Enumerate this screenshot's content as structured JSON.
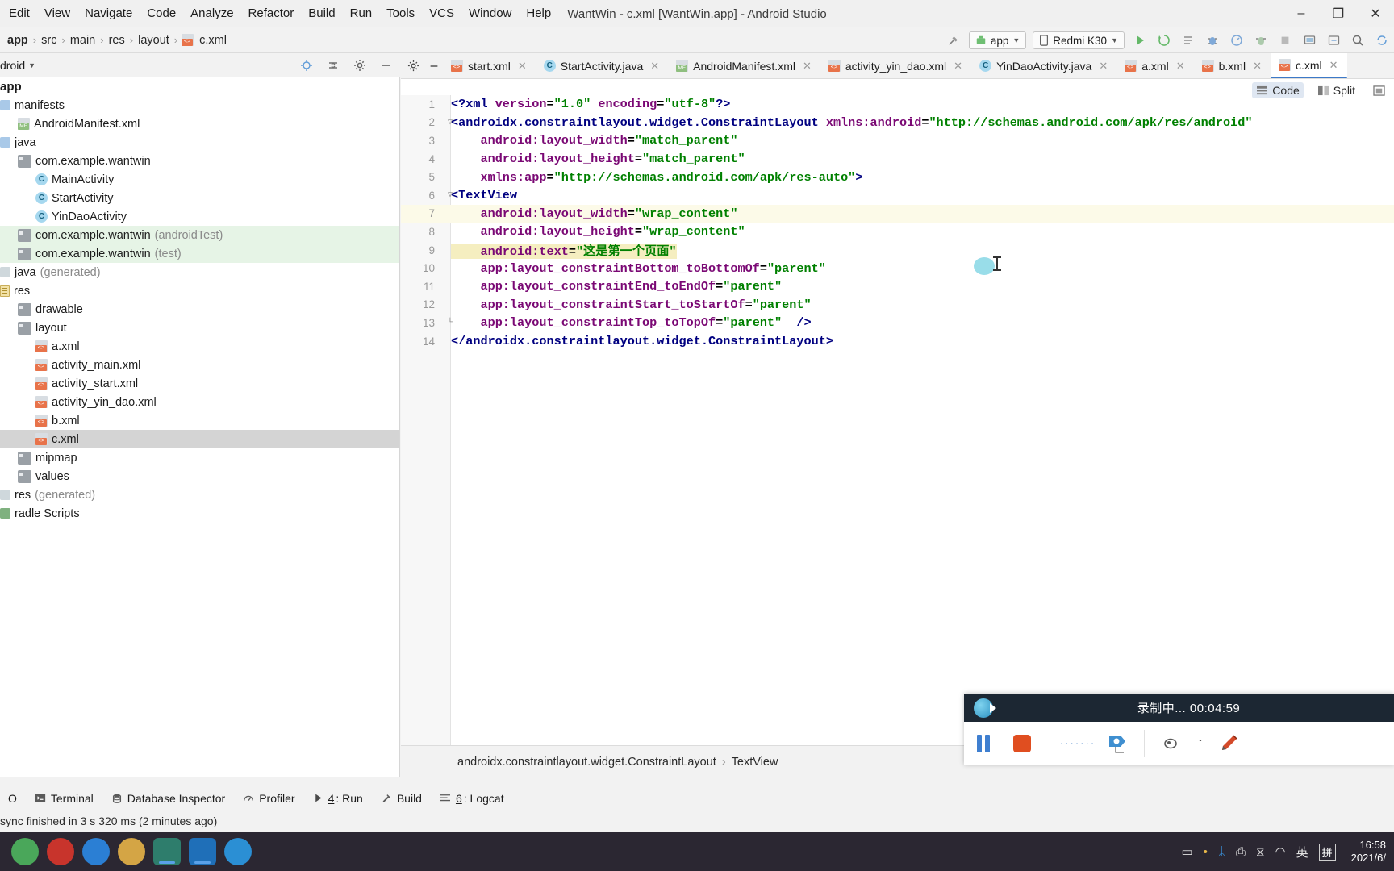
{
  "window": {
    "title": "WantWin - c.xml [WantWin.app] - Android Studio",
    "minimize": "–",
    "maximize": "❐",
    "close": "✕"
  },
  "menubar": [
    {
      "label": "Edit"
    },
    {
      "label": "View"
    },
    {
      "label": "Navigate"
    },
    {
      "label": "Code"
    },
    {
      "label": "Analyze"
    },
    {
      "label": "Refactor"
    },
    {
      "label": "Build"
    },
    {
      "label": "Run"
    },
    {
      "label": "Tools"
    },
    {
      "label": "VCS"
    },
    {
      "label": "Window"
    },
    {
      "label": "Help"
    }
  ],
  "breadcrumb": [
    "app",
    "src",
    "main",
    "res",
    "layout",
    "c.xml"
  ],
  "toolbar": {
    "hammer_icon": "hammer-icon",
    "run_config": "app",
    "device": "Redmi K30",
    "run_icon": "run-icon",
    "rerun_icon": "rerun-icon",
    "debug_icon": "debug-icon",
    "stop_icon": "stop-icon",
    "search_icon": "search-icon"
  },
  "project_panel": {
    "selector": "droid",
    "tree": [
      {
        "label": "app",
        "indent": 0,
        "icon": "app-module-icon",
        "bold": true,
        "state": "normal"
      },
      {
        "label": "manifests",
        "indent": 1,
        "icon": "source-root-icon",
        "state": "normal"
      },
      {
        "label": "AndroidManifest.xml",
        "indent": 2,
        "icon": "manifest-file-icon",
        "state": "normal"
      },
      {
        "label": "java",
        "indent": 1,
        "icon": "source-root-icon",
        "state": "normal"
      },
      {
        "label": "com.example.wantwin",
        "indent": 2,
        "icon": "package-icon",
        "state": "normal"
      },
      {
        "label": "MainActivity",
        "indent": 3,
        "icon": "class-icon",
        "state": "normal"
      },
      {
        "label": "StartActivity",
        "indent": 3,
        "icon": "class-icon",
        "state": "normal"
      },
      {
        "label": "YinDaoActivity",
        "indent": 3,
        "icon": "class-icon",
        "state": "normal"
      },
      {
        "label": "com.example.wantwin",
        "suffix": "(androidTest)",
        "indent": 2,
        "icon": "package-icon",
        "state": "green"
      },
      {
        "label": "com.example.wantwin",
        "suffix": "(test)",
        "indent": 2,
        "icon": "package-icon",
        "state": "green"
      },
      {
        "label": "java",
        "suffix": "(generated)",
        "indent": 1,
        "icon": "generated-icon",
        "state": "normal"
      },
      {
        "label": "res",
        "indent": 1,
        "icon": "res-root-icon",
        "state": "normal"
      },
      {
        "label": "drawable",
        "indent": 2,
        "icon": "package-icon",
        "state": "normal"
      },
      {
        "label": "layout",
        "indent": 2,
        "icon": "package-icon",
        "state": "normal"
      },
      {
        "label": "a.xml",
        "indent": 3,
        "icon": "xml-file-icon",
        "state": "normal"
      },
      {
        "label": "activity_main.xml",
        "indent": 3,
        "icon": "xml-file-icon",
        "state": "normal"
      },
      {
        "label": "activity_start.xml",
        "indent": 3,
        "icon": "xml-file-icon",
        "state": "normal"
      },
      {
        "label": "activity_yin_dao.xml",
        "indent": 3,
        "icon": "xml-file-icon",
        "state": "normal"
      },
      {
        "label": "b.xml",
        "indent": 3,
        "icon": "xml-file-icon",
        "state": "normal"
      },
      {
        "label": "c.xml",
        "indent": 3,
        "icon": "xml-file-icon",
        "state": "selected"
      },
      {
        "label": "mipmap",
        "indent": 2,
        "icon": "package-icon",
        "state": "normal"
      },
      {
        "label": "values",
        "indent": 2,
        "icon": "package-icon",
        "state": "normal"
      },
      {
        "label": "res",
        "suffix": "(generated)",
        "indent": 1,
        "icon": "generated-icon",
        "state": "normal"
      },
      {
        "label": "radle Scripts",
        "indent": 0,
        "icon": "gradle-icon",
        "state": "normal"
      }
    ]
  },
  "editor_tabs": [
    {
      "label": "start.xml",
      "icon": "xml-file-icon",
      "active": false
    },
    {
      "label": "StartActivity.java",
      "icon": "class-icon",
      "active": false
    },
    {
      "label": "AndroidManifest.xml",
      "icon": "manifest-file-icon",
      "active": false
    },
    {
      "label": "activity_yin_dao.xml",
      "icon": "xml-file-icon",
      "active": false
    },
    {
      "label": "YinDaoActivity.java",
      "icon": "class-icon",
      "active": false
    },
    {
      "label": "a.xml",
      "icon": "xml-file-icon",
      "active": false
    },
    {
      "label": "b.xml",
      "icon": "xml-file-icon",
      "active": false
    },
    {
      "label": "c.xml",
      "icon": "xml-file-icon",
      "active": true
    }
  ],
  "view_modes": [
    {
      "label": "Code",
      "icon": "code-view-icon",
      "active": true
    },
    {
      "label": "Split",
      "icon": "split-view-icon",
      "active": false
    },
    {
      "label": "",
      "icon": "design-view-icon",
      "active": false
    }
  ],
  "code": {
    "language": "xml",
    "lines": [
      {
        "n": 1,
        "fold": "",
        "highlight": false,
        "tokens": [
          {
            "t": "<?xml ",
            "c": "tag"
          },
          {
            "t": "version",
            "c": "attr"
          },
          {
            "t": "=",
            "c": "plain"
          },
          {
            "t": "\"1.0\"",
            "c": "val"
          },
          {
            "t": " ",
            "c": "plain"
          },
          {
            "t": "encoding",
            "c": "attr"
          },
          {
            "t": "=",
            "c": "plain"
          },
          {
            "t": "\"utf-8\"",
            "c": "val"
          },
          {
            "t": "?>",
            "c": "tag"
          }
        ]
      },
      {
        "n": 2,
        "fold": "-",
        "highlight": false,
        "tokens": [
          {
            "t": "<androidx.constraintlayout.widget.ConstraintLayout ",
            "c": "tag"
          },
          {
            "t": "xmlns:android",
            "c": "attr"
          },
          {
            "t": "=",
            "c": "plain"
          },
          {
            "t": "\"http://schemas.android.com/apk/res/android\"",
            "c": "val"
          }
        ]
      },
      {
        "n": 3,
        "fold": "",
        "highlight": false,
        "tokens": [
          {
            "t": "    ",
            "c": "plain"
          },
          {
            "t": "android:layout_width",
            "c": "attr"
          },
          {
            "t": "=",
            "c": "plain"
          },
          {
            "t": "\"match_parent\"",
            "c": "val"
          }
        ]
      },
      {
        "n": 4,
        "fold": "",
        "highlight": false,
        "tokens": [
          {
            "t": "    ",
            "c": "plain"
          },
          {
            "t": "android:layout_height",
            "c": "attr"
          },
          {
            "t": "=",
            "c": "plain"
          },
          {
            "t": "\"match_parent\"",
            "c": "val"
          }
        ]
      },
      {
        "n": 5,
        "fold": "",
        "highlight": false,
        "tokens": [
          {
            "t": "    ",
            "c": "plain"
          },
          {
            "t": "xmlns:app",
            "c": "attr"
          },
          {
            "t": "=",
            "c": "plain"
          },
          {
            "t": "\"http://schemas.android.com/apk/res-auto\"",
            "c": "val"
          },
          {
            "t": ">",
            "c": "tag"
          }
        ]
      },
      {
        "n": 6,
        "fold": "-",
        "highlight": false,
        "tokens": [
          {
            "t": "<TextView",
            "c": "tag"
          }
        ]
      },
      {
        "n": 7,
        "fold": "",
        "highlight": true,
        "tokens": [
          {
            "t": "    ",
            "c": "plain"
          },
          {
            "t": "android:layout_width",
            "c": "attr"
          },
          {
            "t": "=",
            "c": "plain"
          },
          {
            "t": "\"wrap_content\"",
            "c": "val"
          }
        ]
      },
      {
        "n": 8,
        "fold": "",
        "highlight": false,
        "tokens": [
          {
            "t": "    ",
            "c": "plain"
          },
          {
            "t": "android:layout_height",
            "c": "attr"
          },
          {
            "t": "=",
            "c": "plain"
          },
          {
            "t": "\"wrap_content\"",
            "c": "val"
          }
        ]
      },
      {
        "n": 9,
        "fold": "",
        "highlight": false,
        "selected": true,
        "tokens": [
          {
            "t": "    ",
            "c": "plain"
          },
          {
            "t": "android:text",
            "c": "attr"
          },
          {
            "t": "=",
            "c": "plain"
          },
          {
            "t": "\"这是第一个页面\"",
            "c": "val"
          }
        ]
      },
      {
        "n": 10,
        "fold": "",
        "highlight": false,
        "tokens": [
          {
            "t": "    ",
            "c": "plain"
          },
          {
            "t": "app:layout_constraintBottom_toBottomOf",
            "c": "attr"
          },
          {
            "t": "=",
            "c": "plain"
          },
          {
            "t": "\"parent\"",
            "c": "val"
          }
        ]
      },
      {
        "n": 11,
        "fold": "",
        "highlight": false,
        "tokens": [
          {
            "t": "    ",
            "c": "plain"
          },
          {
            "t": "app:layout_constraintEnd_toEndOf",
            "c": "attr"
          },
          {
            "t": "=",
            "c": "plain"
          },
          {
            "t": "\"parent\"",
            "c": "val"
          }
        ]
      },
      {
        "n": 12,
        "fold": "",
        "highlight": false,
        "tokens": [
          {
            "t": "    ",
            "c": "plain"
          },
          {
            "t": "app:layout_constraintStart_toStartOf",
            "c": "attr"
          },
          {
            "t": "=",
            "c": "plain"
          },
          {
            "t": "\"parent\"",
            "c": "val"
          }
        ]
      },
      {
        "n": 13,
        "fold": "└",
        "highlight": false,
        "tokens": [
          {
            "t": "    ",
            "c": "plain"
          },
          {
            "t": "app:layout_constraintTop_toTopOf",
            "c": "attr"
          },
          {
            "t": "=",
            "c": "plain"
          },
          {
            "t": "\"parent\"",
            "c": "val"
          },
          {
            "t": "  />",
            "c": "tag"
          }
        ]
      },
      {
        "n": 14,
        "fold": "",
        "highlight": false,
        "tokens": [
          {
            "t": "</androidx.constraintlayout.widget.ConstraintLayout>",
            "c": "tag"
          }
        ]
      }
    ]
  },
  "editor_breadcrumb": [
    "androidx.constraintlayout.widget.ConstraintLayout",
    "TextView"
  ],
  "bottom_tools": [
    {
      "label": "O",
      "icon": "todo-icon",
      "mnemonic": ""
    },
    {
      "label": "Terminal",
      "icon": "terminal-icon",
      "mnemonic": ""
    },
    {
      "label": "Database Inspector",
      "icon": "database-icon",
      "mnemonic": ""
    },
    {
      "label": "Profiler",
      "icon": "profiler-icon",
      "mnemonic": ""
    },
    {
      "label": ": Run",
      "icon": "run-icon",
      "mnemonic": "4"
    },
    {
      "label": "Build",
      "icon": "build-icon",
      "mnemonic": ""
    },
    {
      "label": ": Logcat",
      "icon": "logcat-icon",
      "mnemonic": "6"
    }
  ],
  "status": {
    "message": "sync finished in 3 s 320 ms (2 minutes ago)"
  },
  "recorder": {
    "title": "录制中... 00:04:59",
    "camera_icon": "camera-icon",
    "pause_icon": "pause-icon",
    "stop_icon": "stop-record-icon",
    "dots": "·······",
    "marker_icon": "marker-icon",
    "brush_icon": "brush-icon",
    "pen_icon": "pen-icon",
    "chevron": "ˇ"
  },
  "taskbar": {
    "apps": [
      {
        "name": "chrome-app-icon",
        "color": "#4aa75a"
      },
      {
        "name": "media-app-icon",
        "color": "#c8342c"
      },
      {
        "name": "edge-app-icon",
        "color": "#2b7fd4"
      },
      {
        "name": "folder-app-icon",
        "color": "#d4a545"
      },
      {
        "name": "android-studio-app-icon",
        "color": "#2e7d6c",
        "active": true
      },
      {
        "name": "meeting-app-icon",
        "color": "#1f6fb8",
        "active": true
      },
      {
        "name": "vscode-app-icon",
        "color": "#2b8fd4"
      }
    ],
    "tray": [
      {
        "name": "battery-icon",
        "glyph": "▭"
      },
      {
        "name": "qq-icon",
        "glyph": "•"
      },
      {
        "name": "bluetooth-icon",
        "glyph": "ᛦ"
      },
      {
        "name": "usb-icon",
        "glyph": "⎙"
      },
      {
        "name": "volume-icon",
        "glyph": "⧖"
      },
      {
        "name": "wifi-icon",
        "glyph": "◠"
      },
      {
        "name": "ime-lang-icon",
        "glyph": "英"
      },
      {
        "name": "ime-pinyin-icon",
        "glyph": "拼"
      }
    ],
    "clock_time": "16:58",
    "clock_date": "2021/6/"
  }
}
